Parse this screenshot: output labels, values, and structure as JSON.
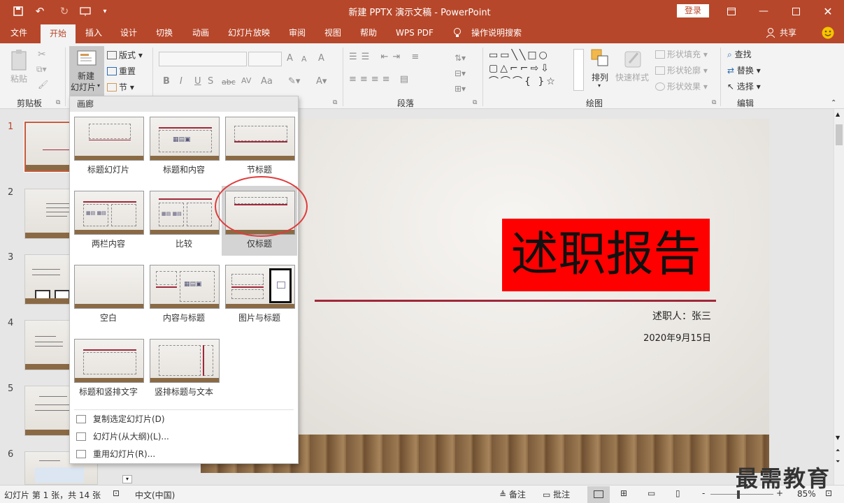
{
  "window": {
    "title": "新建 PPTX 演示文稿  -  PowerPoint",
    "login": "登录",
    "accent": "#b7472a",
    "qat_icons": [
      "save-icon",
      "undo-icon",
      "redo-icon",
      "slideshow-icon",
      "customize-icon"
    ]
  },
  "tabs": [
    "文件",
    "开始",
    "插入",
    "设计",
    "切换",
    "动画",
    "幻灯片放映",
    "审阅",
    "视图",
    "帮助",
    "WPS PDF",
    "操作说明搜索",
    "共享"
  ],
  "ribbon": {
    "clipboard": {
      "paste": "粘贴",
      "group": "剪贴板"
    },
    "slides": {
      "new_slide_line1": "新建",
      "new_slide_line2": "幻灯片",
      "layout": "版式",
      "reset": "重置",
      "section": "节"
    },
    "font": {
      "bold": "B",
      "italic": "I",
      "underline": "U",
      "strike": "S",
      "strike2": "abc",
      "spacing": "AV",
      "case": "Aa",
      "grow": "A",
      "shrink": "A",
      "clear": "A"
    },
    "paragraph": {
      "group": "段落"
    },
    "drawing": {
      "arrange": "排列",
      "quick_styles": "快速样式",
      "fill": "形状填充",
      "outline": "形状轮廓",
      "effects": "形状效果",
      "group": "绘图"
    },
    "editing": {
      "find": "查找",
      "replace": "替换",
      "select": "选择",
      "group": "编辑"
    }
  },
  "thumbnails": [
    "1",
    "2",
    "3",
    "4",
    "5",
    "6"
  ],
  "slide": {
    "title": "述职报告",
    "presenter": "述职人：张三",
    "date": "2020年9月15日"
  },
  "gallery": {
    "header": "画廊",
    "layouts": [
      "标题幻灯片",
      "标题和内容",
      "节标题",
      "两栏内容",
      "比较",
      "仅标题",
      "空白",
      "内容与标题",
      "图片与标题",
      "标题和竖排文字",
      "竖排标题与文本"
    ],
    "menu": [
      "复制选定幻灯片(D)",
      "幻灯片(从大纲)(L)...",
      "重用幻灯片(R)..."
    ]
  },
  "status": {
    "slide_info": "幻灯片 第 1 张，共 14 张",
    "language": "中文(中国)",
    "notes": "备注",
    "comments": "批注",
    "zoom": "85%",
    "zoom_minus": "-",
    "zoom_plus": "+"
  },
  "watermark": "最需教育"
}
